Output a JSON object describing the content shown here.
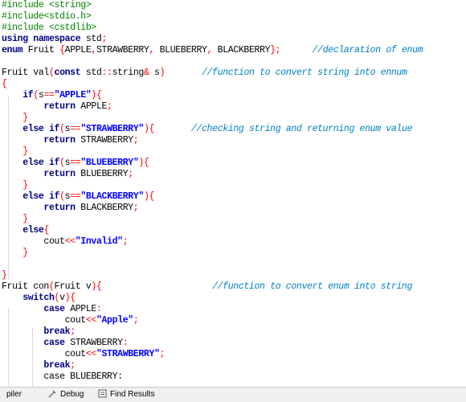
{
  "editor": {
    "lines": [
      [
        {
          "t": "#include <string>",
          "c": "pp"
        }
      ],
      [
        {
          "t": "#include<stdio.h>",
          "c": "pp"
        }
      ],
      [
        {
          "t": "#include <cstdlib>",
          "c": "pp"
        }
      ],
      [
        {
          "t": "using namespace",
          "c": "kw"
        },
        {
          "t": " std",
          "c": "id"
        },
        {
          "t": ";",
          "c": "op"
        }
      ],
      [
        {
          "t": "enum",
          "c": "kw"
        },
        {
          "t": " Fruit ",
          "c": "id"
        },
        {
          "t": "{",
          "c": "op"
        },
        {
          "t": "APPLE",
          "c": "id"
        },
        {
          "t": ",",
          "c": "op"
        },
        {
          "t": "STRAWBERRY",
          "c": "id"
        },
        {
          "t": ",",
          "c": "op"
        },
        {
          "t": " BLUEBERRY",
          "c": "id"
        },
        {
          "t": ",",
          "c": "op"
        },
        {
          "t": " BLACKBERRY",
          "c": "id"
        },
        {
          "t": "};",
          "c": "op"
        },
        {
          "t": "      ",
          "c": "id"
        },
        {
          "t": "//declaration of enum",
          "c": "cm"
        }
      ],
      [],
      [
        {
          "t": "Fruit val",
          "c": "id"
        },
        {
          "t": "(",
          "c": "op"
        },
        {
          "t": "const",
          "c": "kw"
        },
        {
          "t": " std",
          "c": "id"
        },
        {
          "t": "::",
          "c": "op"
        },
        {
          "t": "string",
          "c": "id"
        },
        {
          "t": "&",
          "c": "op"
        },
        {
          "t": " s",
          "c": "id"
        },
        {
          "t": ")",
          "c": "op"
        },
        {
          "t": "       ",
          "c": "id"
        },
        {
          "t": "//function to convert string into ennum",
          "c": "cm"
        }
      ],
      [
        {
          "t": "{",
          "c": "op"
        }
      ],
      [
        {
          "t": "    ",
          "c": "id"
        },
        {
          "t": "if",
          "c": "kw"
        },
        {
          "t": "(",
          "c": "op"
        },
        {
          "t": "s",
          "c": "id"
        },
        {
          "t": "==",
          "c": "op"
        },
        {
          "t": "\"APPLE\"",
          "c": "str"
        },
        {
          "t": "){",
          "c": "op"
        }
      ],
      [
        {
          "t": "        ",
          "c": "id"
        },
        {
          "t": "return",
          "c": "kw"
        },
        {
          "t": " APPLE",
          "c": "id"
        },
        {
          "t": ";",
          "c": "op"
        }
      ],
      [
        {
          "t": "    ",
          "c": "id"
        },
        {
          "t": "}",
          "c": "op"
        }
      ],
      [
        {
          "t": "    ",
          "c": "id"
        },
        {
          "t": "else if",
          "c": "kw"
        },
        {
          "t": "(",
          "c": "op"
        },
        {
          "t": "s",
          "c": "id"
        },
        {
          "t": "==",
          "c": "op"
        },
        {
          "t": "\"STRAWBERRY\"",
          "c": "str"
        },
        {
          "t": "){",
          "c": "op"
        },
        {
          "t": "       ",
          "c": "id"
        },
        {
          "t": "//checking string and returning enum value",
          "c": "cm"
        }
      ],
      [
        {
          "t": "        ",
          "c": "id"
        },
        {
          "t": "return",
          "c": "kw"
        },
        {
          "t": " STRAWBERRY",
          "c": "id"
        },
        {
          "t": ";",
          "c": "op"
        }
      ],
      [
        {
          "t": "    ",
          "c": "id"
        },
        {
          "t": "}",
          "c": "op"
        }
      ],
      [
        {
          "t": "    ",
          "c": "id"
        },
        {
          "t": "else if",
          "c": "kw"
        },
        {
          "t": "(",
          "c": "op"
        },
        {
          "t": "s",
          "c": "id"
        },
        {
          "t": "==",
          "c": "op"
        },
        {
          "t": "\"BLUEBERRY\"",
          "c": "str"
        },
        {
          "t": "){",
          "c": "op"
        }
      ],
      [
        {
          "t": "        ",
          "c": "id"
        },
        {
          "t": "return",
          "c": "kw"
        },
        {
          "t": " BLUEBERRY",
          "c": "id"
        },
        {
          "t": ";",
          "c": "op"
        }
      ],
      [
        {
          "t": "    ",
          "c": "id"
        },
        {
          "t": "}",
          "c": "op"
        }
      ],
      [
        {
          "t": "    ",
          "c": "id"
        },
        {
          "t": "else if",
          "c": "kw"
        },
        {
          "t": "(",
          "c": "op"
        },
        {
          "t": "s",
          "c": "id"
        },
        {
          "t": "==",
          "c": "op"
        },
        {
          "t": "\"BLACKBERRY\"",
          "c": "str"
        },
        {
          "t": "){",
          "c": "op"
        }
      ],
      [
        {
          "t": "        ",
          "c": "id"
        },
        {
          "t": "return",
          "c": "kw"
        },
        {
          "t": " BLACKBERRY",
          "c": "id"
        },
        {
          "t": ";",
          "c": "op"
        }
      ],
      [
        {
          "t": "    ",
          "c": "id"
        },
        {
          "t": "}",
          "c": "op"
        }
      ],
      [
        {
          "t": "    ",
          "c": "id"
        },
        {
          "t": "else",
          "c": "kw"
        },
        {
          "t": "{",
          "c": "op"
        }
      ],
      [
        {
          "t": "        ",
          "c": "id"
        },
        {
          "t": "cout",
          "c": "id"
        },
        {
          "t": "<<",
          "c": "op"
        },
        {
          "t": "\"Invalid\"",
          "c": "str"
        },
        {
          "t": ";",
          "c": "op"
        }
      ],
      [
        {
          "t": "    ",
          "c": "id"
        },
        {
          "t": "}",
          "c": "op"
        }
      ],
      [],
      [
        {
          "t": "}",
          "c": "op"
        }
      ],
      [
        {
          "t": "Fruit con",
          "c": "id"
        },
        {
          "t": "(",
          "c": "op"
        },
        {
          "t": "Fruit v",
          "c": "id"
        },
        {
          "t": "){",
          "c": "op"
        },
        {
          "t": "                     ",
          "c": "id"
        },
        {
          "t": "//function to convert enum into string",
          "c": "cm"
        }
      ],
      [
        {
          "t": "    ",
          "c": "id"
        },
        {
          "t": "switch",
          "c": "kw"
        },
        {
          "t": "(",
          "c": "op"
        },
        {
          "t": "v",
          "c": "id"
        },
        {
          "t": "){",
          "c": "op"
        }
      ],
      [
        {
          "t": "        ",
          "c": "id"
        },
        {
          "t": "case",
          "c": "kw"
        },
        {
          "t": " APPLE",
          "c": "id"
        },
        {
          "t": ":",
          "c": "op"
        }
      ],
      [
        {
          "t": "            ",
          "c": "id"
        },
        {
          "t": "cout",
          "c": "id"
        },
        {
          "t": "<<",
          "c": "op"
        },
        {
          "t": "\"Apple\"",
          "c": "str"
        },
        {
          "t": ";",
          "c": "op"
        }
      ],
      [
        {
          "t": "        ",
          "c": "id"
        },
        {
          "t": "break",
          "c": "kw"
        },
        {
          "t": ";",
          "c": "op"
        }
      ],
      [
        {
          "t": "        ",
          "c": "id"
        },
        {
          "t": "case",
          "c": "kw"
        },
        {
          "t": " STRAWBERRY",
          "c": "id"
        },
        {
          "t": ":",
          "c": "op"
        }
      ],
      [
        {
          "t": "            ",
          "c": "id"
        },
        {
          "t": "cout",
          "c": "id"
        },
        {
          "t": "<<",
          "c": "op"
        },
        {
          "t": "\"STRAWBERRY\"",
          "c": "str"
        },
        {
          "t": ";",
          "c": "op"
        }
      ],
      [
        {
          "t": "        ",
          "c": "id"
        },
        {
          "t": "break",
          "c": "kw"
        },
        {
          "t": ";",
          "c": "op"
        }
      ],
      [
        {
          "t": "        ",
          "c": "id"
        },
        {
          "t": "case BLUEBERRY:",
          "c": "id"
        }
      ]
    ]
  },
  "bottom_tabs": [
    {
      "label": "piler",
      "icon": ""
    },
    {
      "label": "Debug",
      "icon": "debug-icon"
    },
    {
      "label": "Find Results",
      "icon": "find-results-icon"
    }
  ]
}
